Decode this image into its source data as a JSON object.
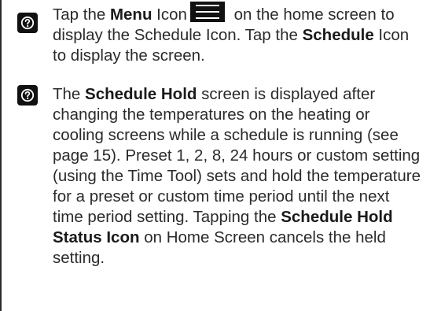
{
  "notes": [
    {
      "icon": "question-circle-icon",
      "t1": "Tap the ",
      "b1": "Menu",
      "t2": " Icon",
      "inline_icon": "hamburger-menu-icon",
      "t3": " on the home screen to display the Schedule Icon. Tap the ",
      "b2": "Schedule",
      "t4": " Icon to display the screen."
    },
    {
      "icon": "question-circle-icon",
      "t1": "The ",
      "b1": "Schedule Hold",
      "t2": " screen is displayed after changing the temperatures on the heating or cooling screens while a schedule is running (see page 15). Preset 1, 2, 8, 24 hours or custom setting (using the Time Tool) sets and hold the temperature for a preset or custom time period until the next time period setting. Tapping the ",
      "b2": "Schedule Hold Status Icon",
      "t3": " on Home Screen cancels the held setting."
    }
  ],
  "colors": {
    "text": "#2b2b2b",
    "icon_bg": "#111111"
  }
}
